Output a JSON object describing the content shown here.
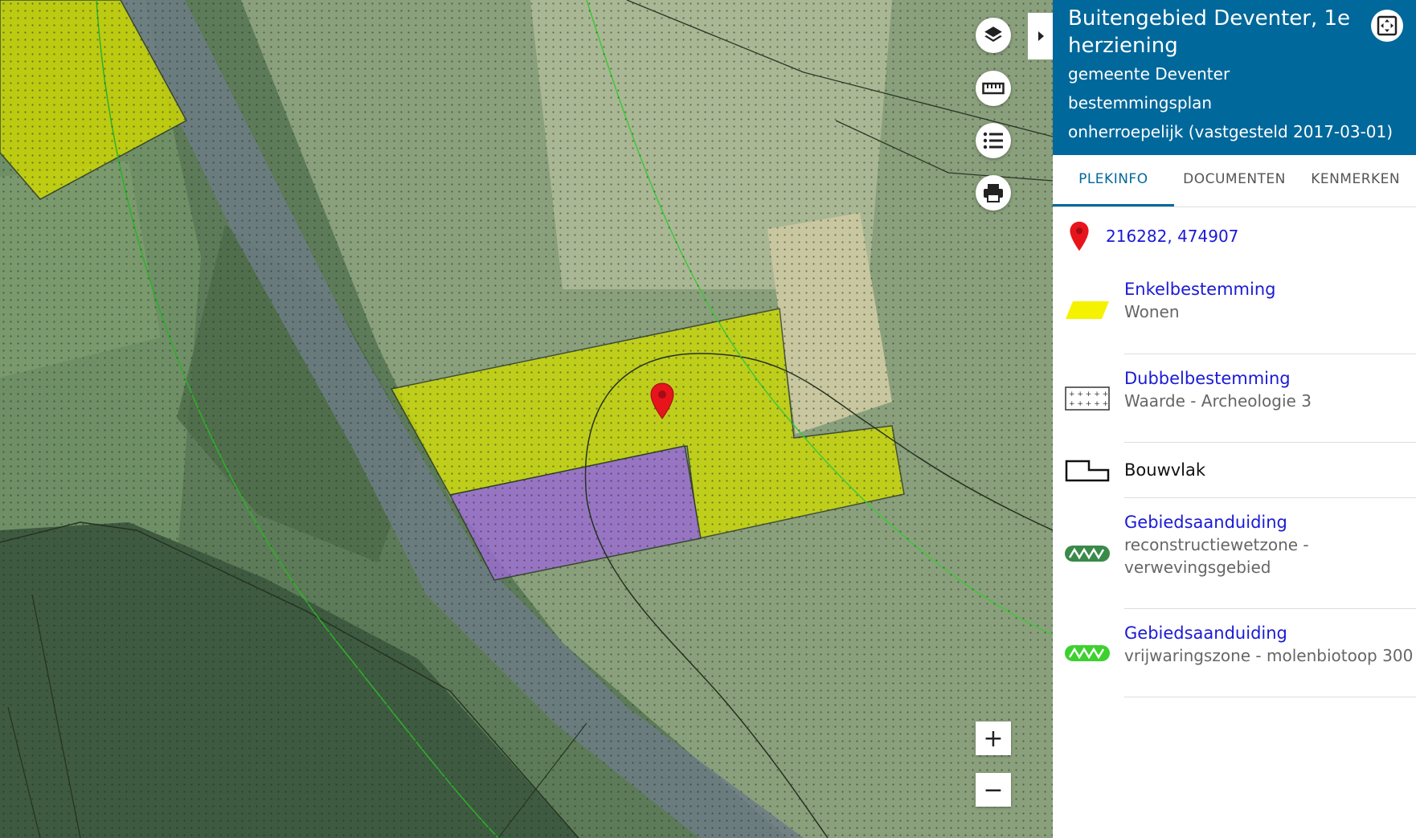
{
  "panel": {
    "title": "Buitengebied Deventer, 1e herziening",
    "municipality": "gemeente Deventer",
    "plan_type": "bestemmingsplan",
    "status": "onherroepelijk (vastgesteld 2017-03-01)"
  },
  "tabs": [
    {
      "label": "PLEKINFO",
      "active": true
    },
    {
      "label": "DOCUMENTEN",
      "active": false
    },
    {
      "label": "KENMERKEN",
      "active": false
    }
  ],
  "location": {
    "coordinates": "216282, 474907"
  },
  "items": [
    {
      "label": "Enkelbestemming",
      "value": "Wonen"
    },
    {
      "label": "Dubbelbestemming",
      "value": "Waarde - Archeologie 3"
    },
    {
      "label": "Bouwvlak"
    },
    {
      "label": "Gebiedsaanduiding",
      "value": "reconstructiewetzone - verwevingsgebied"
    },
    {
      "label": "Gebiedsaanduiding",
      "value": "vrijwaringszone - molenbiotoop 300"
    }
  ],
  "map": {
    "controls": [
      "layers-icon",
      "ruler-icon",
      "legend-list-icon",
      "print-icon"
    ],
    "zoom_in": "+",
    "zoom_out": "−"
  },
  "colors": {
    "header": "#01689b",
    "link": "#1a1ad6",
    "wonen": "#e5f000",
    "bedrijf": "#b070d8",
    "marker": "#e8141c"
  }
}
